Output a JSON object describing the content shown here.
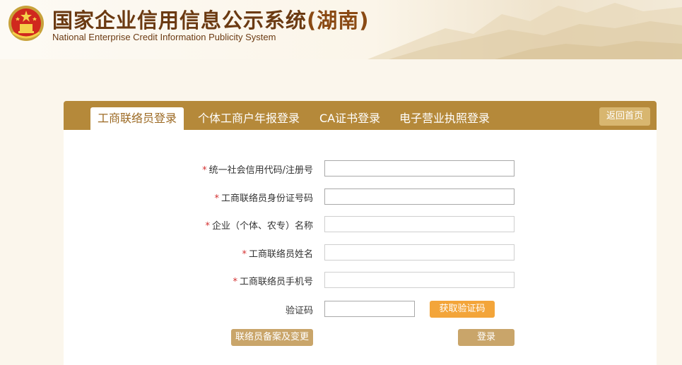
{
  "header": {
    "title_cn": "国家企业信用信息公示系统",
    "title_province": "(湖南)",
    "title_en": "National Enterprise Credit Information Publicity System"
  },
  "tabs": [
    {
      "label": "工商联络员登录",
      "active": true
    },
    {
      "label": "个体工商户年报登录",
      "active": false
    },
    {
      "label": "CA证书登录",
      "active": false
    },
    {
      "label": "电子营业执照登录",
      "active": false
    }
  ],
  "back_button": "返回首页",
  "form": {
    "fields": [
      {
        "label": "统一社会信用代码/注册号",
        "required": true,
        "value": ""
      },
      {
        "label": "工商联络员身份证号码",
        "required": true,
        "value": ""
      },
      {
        "label": "企业（个体、农专）名称",
        "required": true,
        "value": ""
      },
      {
        "label": "工商联络员姓名",
        "required": true,
        "value": ""
      },
      {
        "label": "工商联络员手机号",
        "required": true,
        "value": ""
      }
    ],
    "captcha_label": "验证码",
    "captcha_value": "",
    "get_captcha_button": "获取验证码",
    "register_button": "联络员备案及变更",
    "login_button": "登录",
    "required_mark": "*"
  },
  "colors": {
    "tab_bar": "#b5893a",
    "active_tab_text": "#9c6a24",
    "captcha_button": "#f3a53a",
    "action_button": "#c9a56a",
    "required_star": "#d32f2f",
    "title": "#6b3a12"
  }
}
